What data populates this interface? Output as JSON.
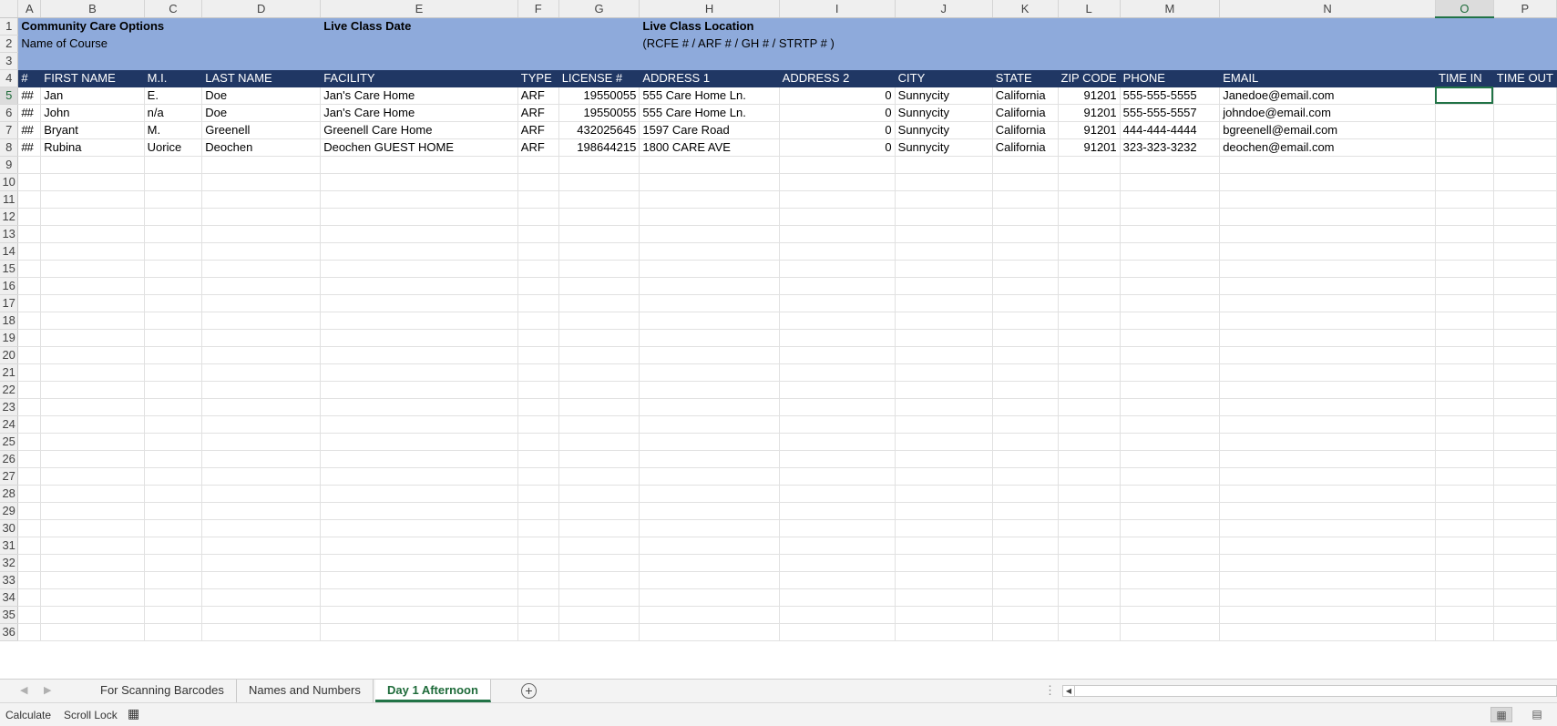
{
  "columns": [
    "A",
    "B",
    "C",
    "D",
    "E",
    "F",
    "G",
    "H",
    "I",
    "J",
    "K",
    "L",
    "M",
    "N",
    "O",
    "P"
  ],
  "active_cell": "O5",
  "rows": {
    "r1": {
      "num": "1",
      "A": "Community Care Options",
      "E": "Live Class Date",
      "H": "Live Class Location"
    },
    "r2": {
      "num": "2",
      "A": "Name of Course",
      "H": "(RCFE # / ARF # / GH # / STRTP # )"
    },
    "r3": {
      "num": "3"
    },
    "r4": {
      "num": "4",
      "A": "#",
      "B": "FIRST NAME",
      "C": "M.I.",
      "D": "LAST NAME",
      "E": "FACILITY",
      "F": "TYPE",
      "G": "LICENSE #",
      "H": "ADDRESS 1",
      "I": "ADDRESS 2",
      "J": "CITY",
      "K": "STATE",
      "L": "ZIP CODE",
      "M": "PHONE",
      "N": "EMAIL",
      "O": "TIME IN",
      "P": "TIME OUT"
    },
    "r5": {
      "num": "5",
      "A": "##",
      "B": "Jan",
      "C": "E.",
      "D": "Doe",
      "E": "Jan's Care Home",
      "F": "ARF",
      "G": "19550055",
      "H": "555 Care Home Ln.",
      "I": "0",
      "J": "Sunnycity",
      "K": "California",
      "L": "91201",
      "M": "555-555-5555",
      "N": "Janedoe@email.com"
    },
    "r6": {
      "num": "6",
      "A": "##",
      "B": "John",
      "C": "n/a",
      "D": "Doe",
      "E": "Jan's Care Home",
      "F": "ARF",
      "G": "19550055",
      "H": "555 Care Home Ln.",
      "I": "0",
      "J": "Sunnycity",
      "K": "California",
      "L": "91201",
      "M": "555-555-5557",
      "N": "johndoe@email.com"
    },
    "r7": {
      "num": "7",
      "A": "##",
      "B": "Bryant",
      "C": "M.",
      "D": "Greenell",
      "E": "Greenell Care Home",
      "F": "ARF",
      "G": "432025645",
      "H": "1597 Care Road",
      "I": "0",
      "J": "Sunnycity",
      "K": "California",
      "L": "91201",
      "M": "444-444-4444",
      "N": "bgreenell@email.com"
    },
    "r8": {
      "num": "8",
      "A": "##",
      "B": "Rubina",
      "C": "Uorice",
      "D": "Deochen",
      "E": "Deochen GUEST HOME",
      "F": "ARF",
      "G": "198644215",
      "H": "1800 CARE AVE",
      "I": "0",
      "J": "Sunnycity",
      "K": "California",
      "L": "91201",
      "M": "323-323-3232",
      "N": "deochen@email.com"
    }
  },
  "empty_rows": [
    "9",
    "10",
    "11",
    "12",
    "13",
    "14",
    "15",
    "16",
    "17",
    "18",
    "19",
    "20",
    "21",
    "22",
    "23",
    "24",
    "25",
    "26",
    "27",
    "28",
    "29",
    "30",
    "31",
    "32",
    "33",
    "34",
    "35",
    "36"
  ],
  "tabs": {
    "sheet1": "For Scanning Barcodes",
    "sheet2": "Names and Numbers",
    "sheet3": "Day 1 Afternoon",
    "add_icon": "+"
  },
  "status": {
    "calculate": "Calculate",
    "scroll_lock": "Scroll Lock"
  },
  "colors": {
    "header_band": "#8eaadb",
    "table_header": "#203764",
    "accent_green": "#217346"
  }
}
